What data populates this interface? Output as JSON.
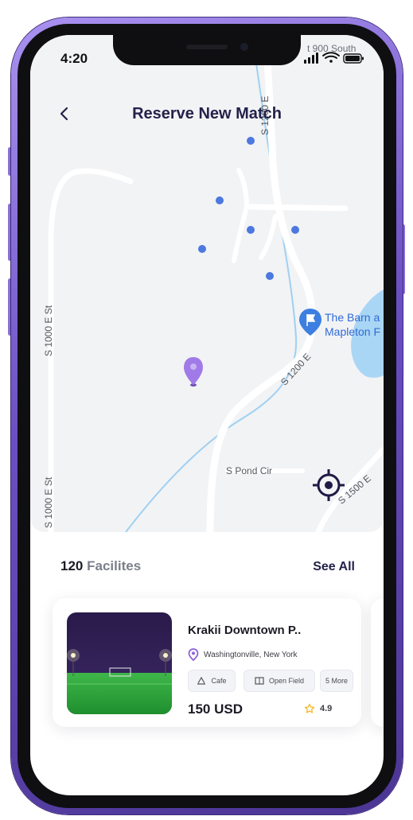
{
  "status_bar": {
    "time": "4:20"
  },
  "map": {
    "labels": {
      "s_1200_e_top": "S 1200 E",
      "s_1200_e_mid": "S 1200 E",
      "s_1000_e_st_top": "S 1000 E St",
      "s_1000_e_st_bottom": "S 1000 E St",
      "s_pond_cir": "S Pond Cir",
      "s_1500_e": "S 1500 E",
      "street_corner": "t 900 South"
    },
    "poi": {
      "line1": "The Barn a",
      "line2": "Mapleton F"
    },
    "colors": {
      "background": "#f2f3f5",
      "road": "#ffffff",
      "river": "#9fd0f2",
      "lake": "#a9d6f5",
      "dot": "#4c78e0",
      "pin": "#9b6fe0"
    }
  },
  "header": {
    "title": "Reserve New Match",
    "back_icon": "chevron-left-icon"
  },
  "facilities": {
    "count": "120",
    "label": "Facilites",
    "see_all": "See All"
  },
  "card": {
    "title": "Krakii Downtown P..",
    "location": "Washingtonville, New York",
    "chips": [
      "Cafe",
      "Open Field",
      "5 More"
    ],
    "price": "150 USD",
    "rating": "4.9"
  },
  "accent_colors": {
    "title": "#23224a",
    "star": "#f5b724",
    "location_icon": "#8c64d8"
  }
}
